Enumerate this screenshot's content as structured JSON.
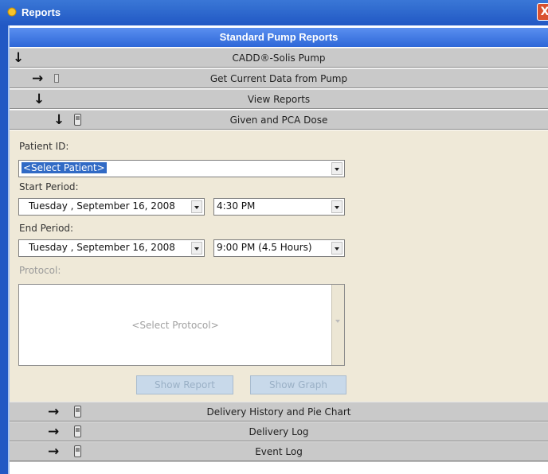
{
  "window": {
    "title": "Reports",
    "close_label": "X"
  },
  "header": {
    "title": "Standard Pump Reports"
  },
  "tree": {
    "pump": "CADD®-Solis Pump",
    "get_data": "Get Current Data from Pump",
    "view_reports": "View Reports",
    "given_pca": "Given and PCA Dose",
    "delivery_history": "Delivery History and Pie Chart",
    "delivery_log": "Delivery Log",
    "event_log": "Event Log"
  },
  "form": {
    "patient_label": "Patient ID:",
    "patient_value": "<Select Patient>",
    "start_label": "Start Period:",
    "start_date": "Tuesday   , September 16, 2008",
    "start_time": "4:30 PM",
    "end_label": "End Period:",
    "end_date": "Tuesday   , September 16, 2008",
    "end_time": "9:00 PM (4.5 Hours)",
    "protocol_label": "Protocol:",
    "protocol_placeholder": "<Select Protocol>",
    "show_report": "Show Report",
    "show_graph": "Show Graph"
  },
  "icons": {
    "arrow_down": "down-arrow-icon",
    "arrow_right": "right-arrow-icon",
    "device": "report-device-icon"
  },
  "colors": {
    "header_blue": "#2e67d8",
    "panel_bg": "#efe9d8",
    "row_gray": "#c9c9c9"
  }
}
